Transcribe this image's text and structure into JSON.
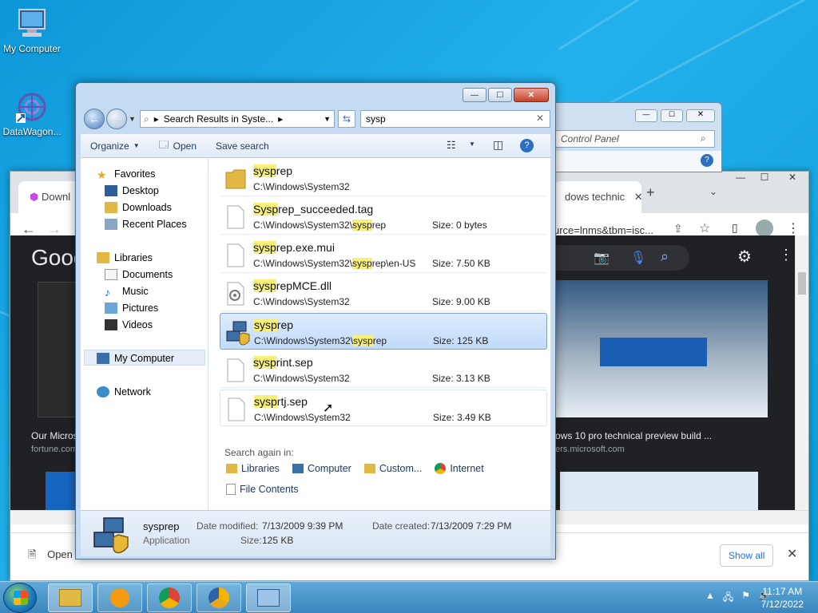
{
  "desktop": {
    "icons": [
      {
        "label": "My Computer"
      },
      {
        "label": "DataWagon..."
      }
    ]
  },
  "chrome": {
    "tab1_label": "Downl",
    "tab2_label": "dows technic",
    "url_text": "urce=lnms&tbm=isc...",
    "result_left_title": "Our Micros",
    "result_left_source": "fortune.com",
    "result_right_title": "ows 10 pro technical preview build ...",
    "result_right_source": "ers.microsoft.com",
    "google_logo": "Goog",
    "download_name": "Open",
    "show_all": "Show all"
  },
  "control_panel": {
    "address": "Control Panel"
  },
  "explorer": {
    "breadcrumb": "Search Results in Syste...",
    "search_value": "sysp",
    "toolbar": {
      "organize": "Organize",
      "open": "Open",
      "save_search": "Save search"
    },
    "nav": {
      "favorites": "Favorites",
      "desktop": "Desktop",
      "downloads": "Downloads",
      "recent": "Recent Places",
      "libraries": "Libraries",
      "documents": "Documents",
      "music": "Music",
      "pictures": "Pictures",
      "videos": "Videos",
      "computer": "My Computer",
      "network": "Network"
    },
    "results": [
      {
        "name_hl": "sysp",
        "name_rest": "rep",
        "path_pre": "C:\\Windows\\System32",
        "path_hl": "",
        "path_post": "",
        "size": ""
      },
      {
        "name_hl": "Sysp",
        "name_rest": "rep_succeeded.tag",
        "path_pre": "C:\\Windows\\System32\\",
        "path_hl": "sysp",
        "path_post": "rep",
        "size": "Size: 0 bytes"
      },
      {
        "name_hl": "sysp",
        "name_rest": "rep.exe.mui",
        "path_pre": "C:\\Windows\\System32\\",
        "path_hl": "sysp",
        "path_post": "rep\\en-US",
        "size": "Size: 7.50 KB"
      },
      {
        "name_hl": "sysp",
        "name_rest": "repMCE.dll",
        "path_pre": "C:\\Windows\\System32",
        "path_hl": "",
        "path_post": "",
        "size": "Size: 9.00 KB"
      },
      {
        "name_hl": "sysp",
        "name_rest": "rep",
        "path_pre": "C:\\Windows\\System32\\",
        "path_hl": "sysp",
        "path_post": "rep",
        "size": "Size: 125 KB"
      },
      {
        "name_hl": "sysp",
        "name_rest": "rint.sep",
        "path_pre": "C:\\Windows\\System32",
        "path_hl": "",
        "path_post": "",
        "size": "Size: 3.13 KB"
      },
      {
        "name_hl": "sysp",
        "name_rest": "rtj.sep",
        "path_pre": "C:\\Windows\\System32",
        "path_hl": "",
        "path_post": "",
        "size": "Size: 3.49 KB"
      }
    ],
    "search_again_label": "Search again in:",
    "search_again": {
      "libraries": "Libraries",
      "computer": "Computer",
      "custom": "Custom...",
      "internet": "Internet",
      "file_contents": "File Contents"
    },
    "details": {
      "name": "sysprep",
      "type": "Application",
      "modified_label": "Date modified:",
      "modified_value": "7/13/2009 9:39 PM",
      "created_label": "Date created:",
      "created_value": "7/13/2009 7:29 PM",
      "size_label": "Size:",
      "size_value": "125 KB"
    }
  },
  "taskbar": {
    "time": "11:17 AM",
    "date": "7/12/2022"
  }
}
